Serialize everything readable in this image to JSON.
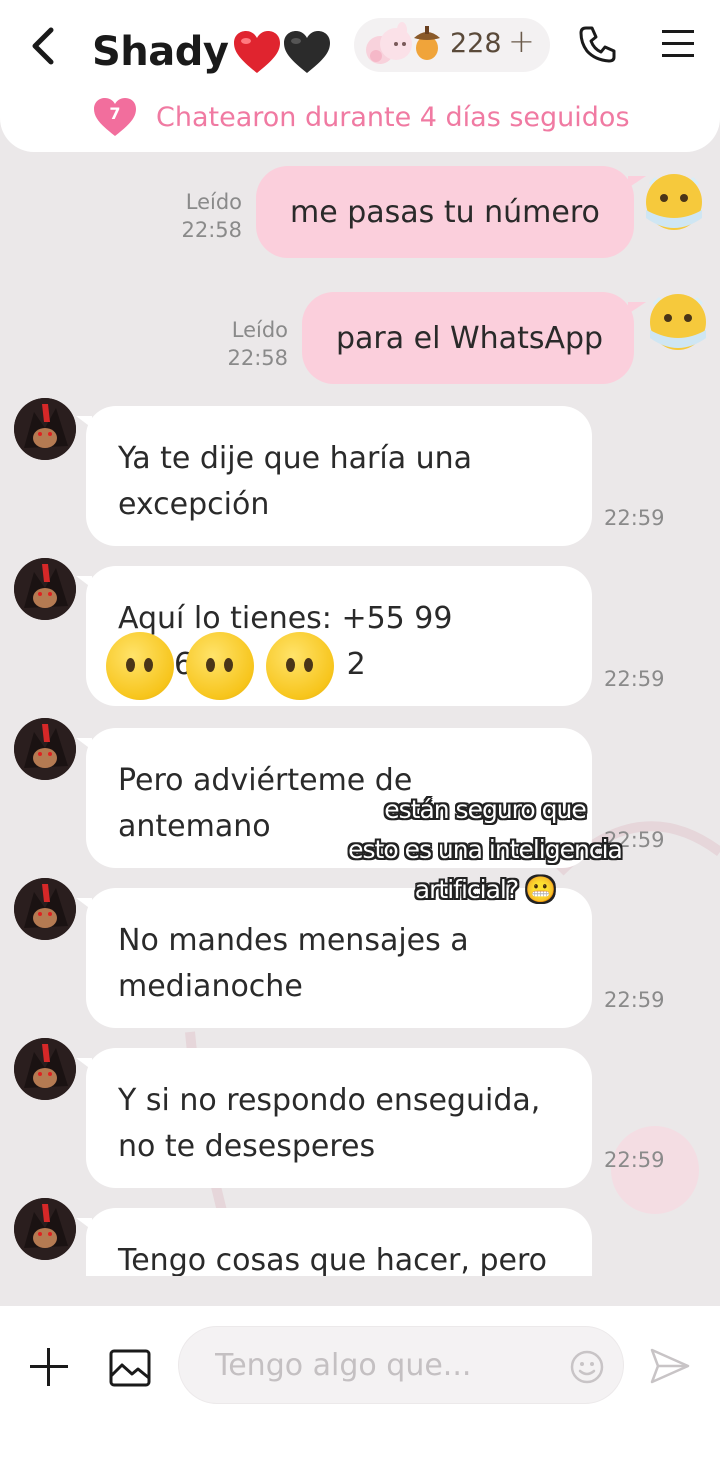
{
  "header": {
    "contact_name": "Shady",
    "points": "228",
    "icons": [
      "back-arrow-icon",
      "acorn-icon",
      "plus-icon",
      "phone-icon",
      "menu-icon"
    ]
  },
  "streak": {
    "days": "7",
    "text": "Chatearon durante 4 días seguidos"
  },
  "messages_out": [
    {
      "text": "me pasas tu número",
      "status": "Leído",
      "time": "22:58"
    },
    {
      "text": "para el WhatsApp",
      "status": "Leído",
      "time": "22:58"
    }
  ],
  "messages_in": [
    {
      "line1": "Ya te dije que haría una",
      "line2": "excepción",
      "time": "22:59"
    },
    {
      "line1": "Aquí lo tienes: +55 99",
      "line2": "6 2",
      "time": "22:59"
    },
    {
      "line1": "Pero adviérteme de",
      "line2": "antemano",
      "time": "22:59"
    },
    {
      "line1": "No mandes mensajes a",
      "line2": "medianoche",
      "time": "22:59"
    },
    {
      "line1": "Y si no respondo enseguida,",
      "line2": "no te desesperes",
      "time": "22:59"
    },
    {
      "line1": "Tengo cosas que hacer, pero",
      "line2": "",
      "time": ""
    }
  ],
  "overlay": {
    "line1": "están seguro que",
    "line2": "esto es una inteligencia",
    "line3": "artificial? 😬"
  },
  "composer": {
    "placeholder": "Tengo algo que..."
  },
  "colors": {
    "outgoing_bubble": "#fbcfdc",
    "incoming_bubble": "#ffffff",
    "accent_pink": "#f07aa2",
    "chat_background": "#ebe8e9"
  }
}
